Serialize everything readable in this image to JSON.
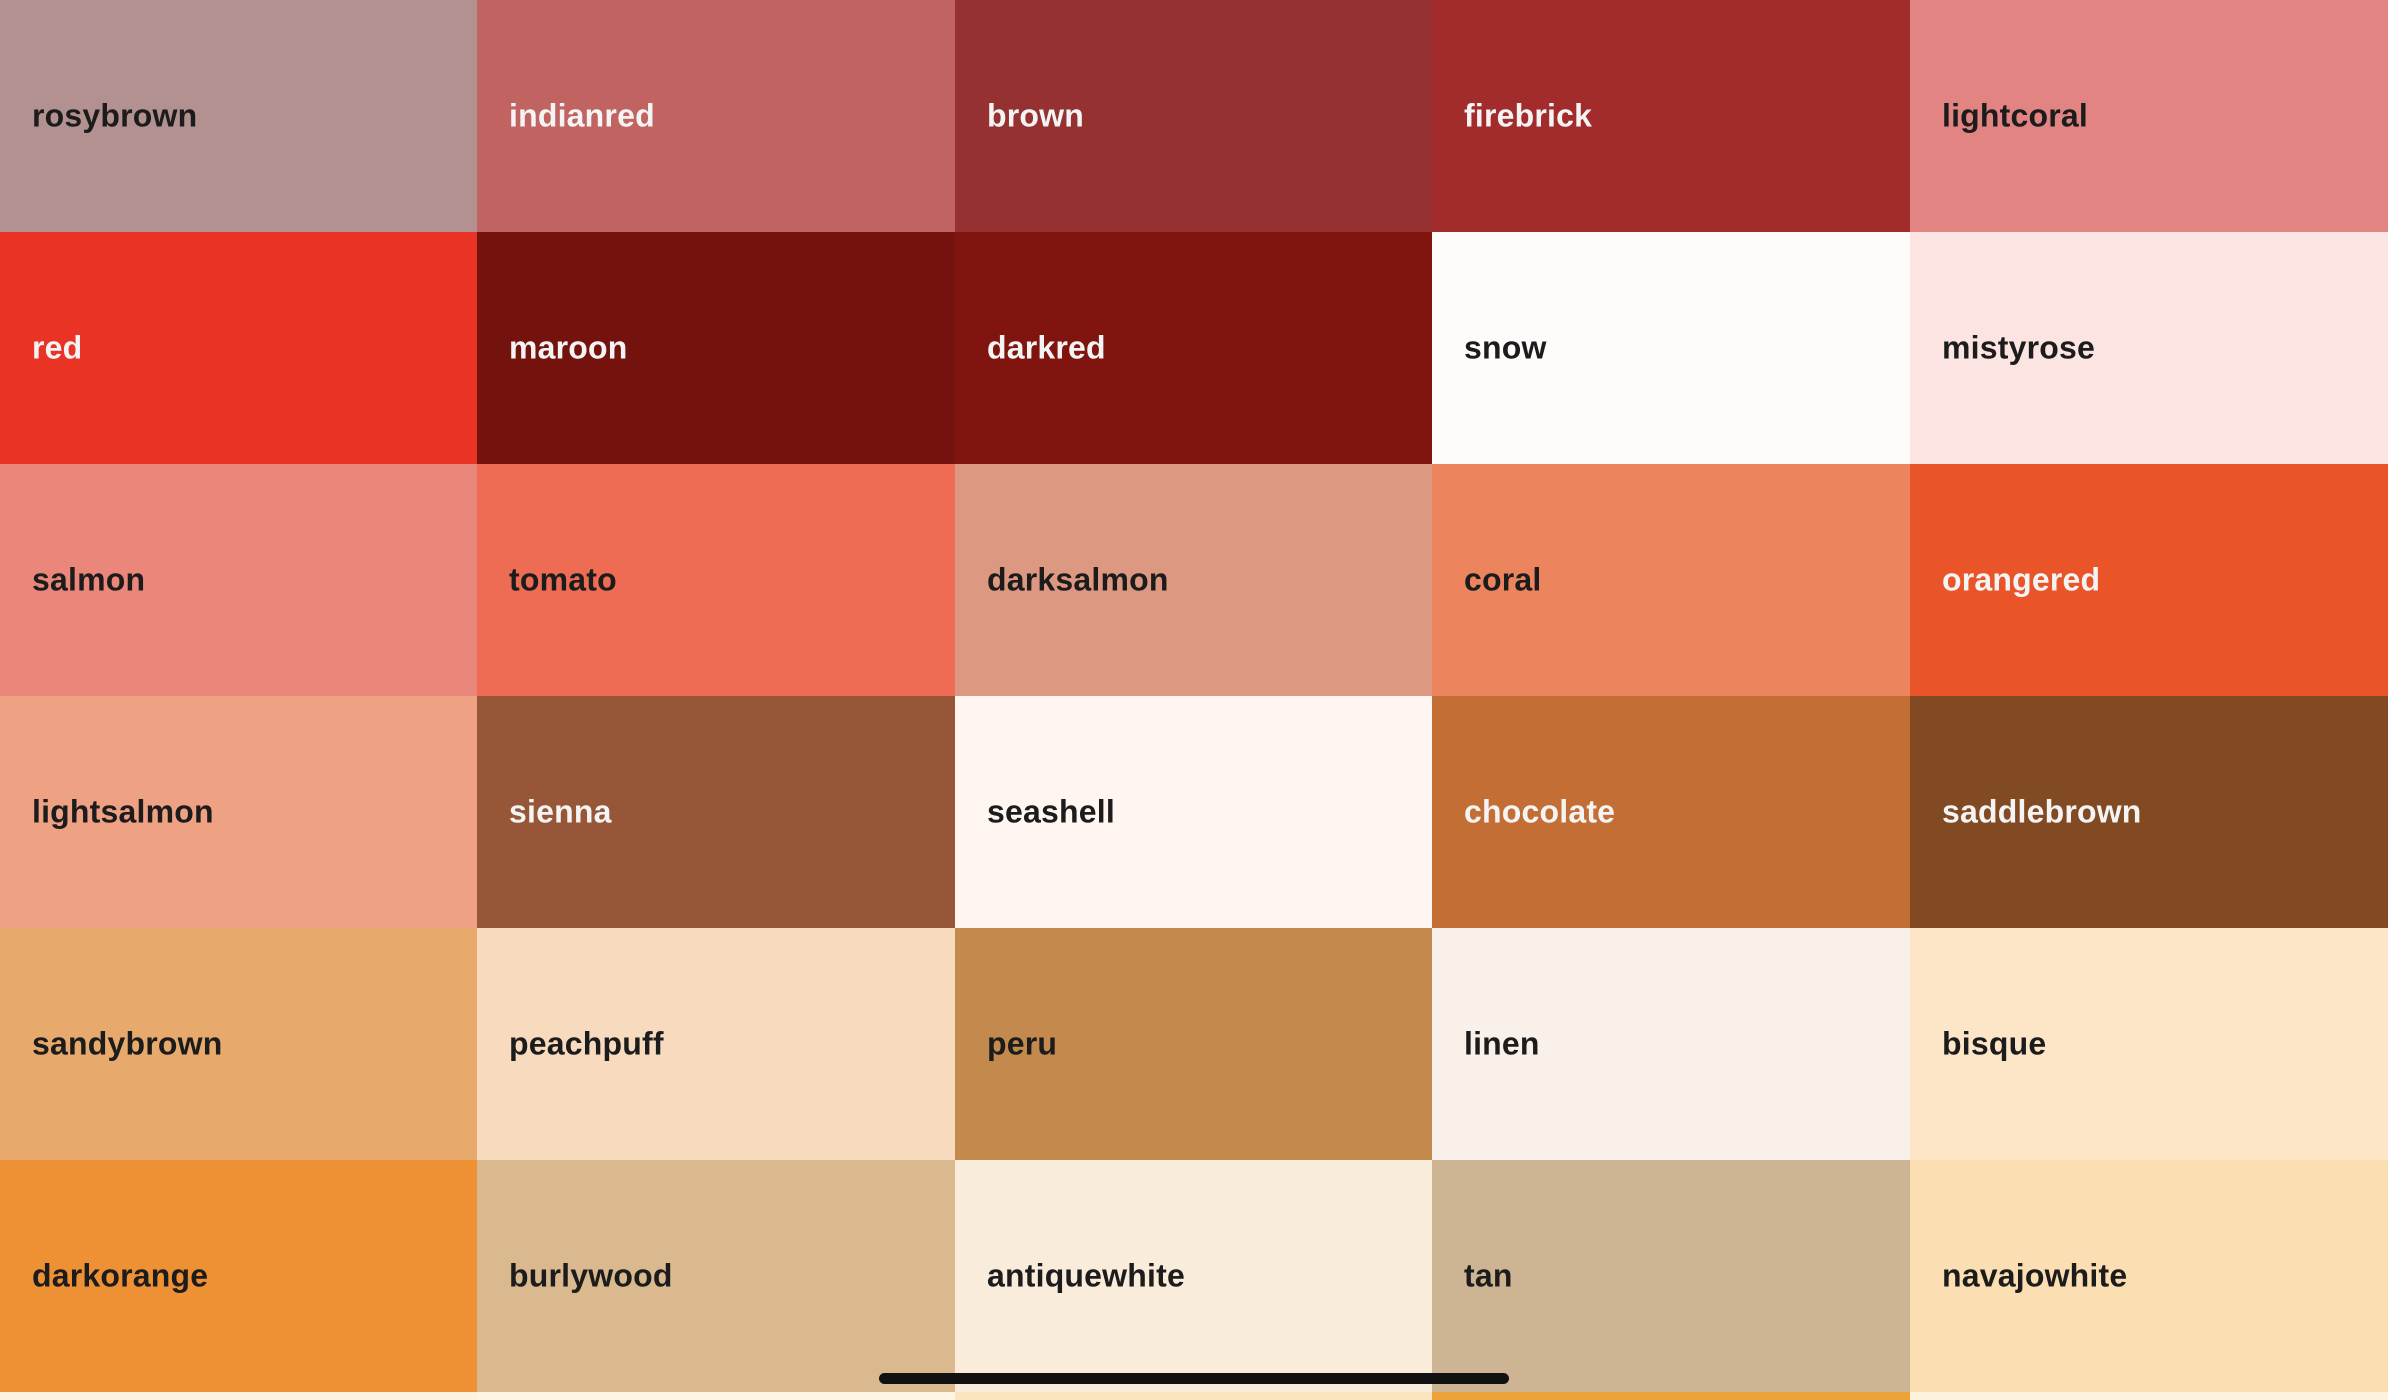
{
  "swatches": [
    {
      "label": "rosybrown",
      "color": "#b39190",
      "text": "dark"
    },
    {
      "label": "indianred",
      "color": "#c16361",
      "text": "light"
    },
    {
      "label": "brown",
      "color": "#963131",
      "text": "light"
    },
    {
      "label": "firebrick",
      "color": "#a22c2c",
      "text": "light"
    },
    {
      "label": "lightcoral",
      "color": "#e18482",
      "text": "dark"
    },
    {
      "label": "red",
      "color": "#e93425",
      "text": "light"
    },
    {
      "label": "maroon",
      "color": "#74130d",
      "text": "light"
    },
    {
      "label": "darkred",
      "color": "#80140e",
      "text": "light"
    },
    {
      "label": "snow",
      "color": "#fffbfa",
      "text": "dark"
    },
    {
      "label": "mistyrose",
      "color": "#fbe4e1",
      "text": "dark"
    },
    {
      "label": "salmon",
      "color": "#eb877a",
      "text": "dark"
    },
    {
      "label": "tomato",
      "color": "#ed6c53",
      "text": "dark"
    },
    {
      "label": "darksalmon",
      "color": "#dc9881",
      "text": "dark"
    },
    {
      "label": "coral",
      "color": "#ec855d",
      "text": "dark"
    },
    {
      "label": "orangered",
      "color": "#e95429",
      "text": "light"
    },
    {
      "label": "lightsalmon",
      "color": "#efa283",
      "text": "dark"
    },
    {
      "label": "sienna",
      "color": "#965637",
      "text": "light"
    },
    {
      "label": "seashell",
      "color": "#fff6f1",
      "text": "dark"
    },
    {
      "label": "chocolate",
      "color": "#c36e34",
      "text": "light"
    },
    {
      "label": "saddlebrown",
      "color": "#824a22",
      "text": "light"
    },
    {
      "label": "sandybrown",
      "color": "#e8a96c",
      "text": "dark"
    },
    {
      "label": "peachpuff",
      "color": "#f8dbbe",
      "text": "dark"
    },
    {
      "label": "peru",
      "color": "#c3894d",
      "text": "dark"
    },
    {
      "label": "linen",
      "color": "#f9f0e9",
      "text": "dark"
    },
    {
      "label": "bisque",
      "color": "#fde5c7",
      "text": "dark"
    },
    {
      "label": "darkorange",
      "color": "#ee9135",
      "text": "dark"
    },
    {
      "label": "burlywood",
      "color": "#d9b98d",
      "text": "dark"
    },
    {
      "label": "antiquewhite",
      "color": "#f9ecdb",
      "text": "dark"
    },
    {
      "label": "tan",
      "color": "#cdb593",
      "text": "dark"
    },
    {
      "label": "navajowhite",
      "color": "#fbdfb2",
      "text": "dark"
    }
  ],
  "partial_row_colors": [
    "#fdf3dc",
    "#fdf6e5",
    "#fbe5bf",
    "#eea33a",
    "#fdf3dc"
  ]
}
